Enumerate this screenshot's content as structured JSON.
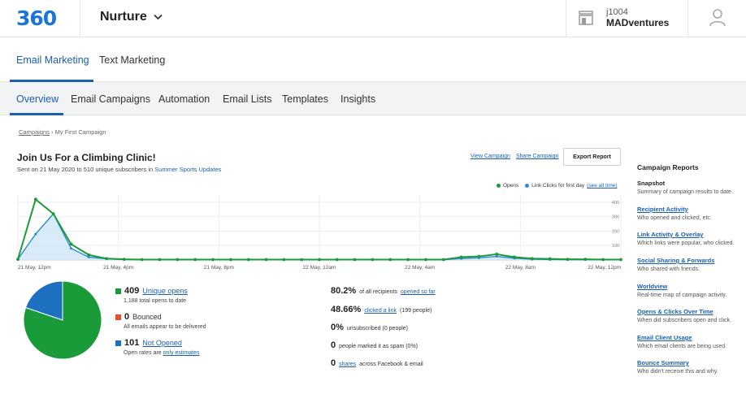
{
  "header": {
    "logo_text": "360",
    "product": "Nurture",
    "account_id": "j1004",
    "account_name": "MADventures"
  },
  "tabs_primary": [
    {
      "label": "Email Marketing",
      "active": true
    },
    {
      "label": "Text Marketing",
      "active": false
    }
  ],
  "tabs_secondary": [
    {
      "label": "Overview",
      "active": true
    },
    {
      "label": "Email Campaigns",
      "active": false
    },
    {
      "label": "Automation",
      "active": false
    },
    {
      "label": "Email Lists",
      "active": false
    },
    {
      "label": "Templates",
      "active": false
    },
    {
      "label": "Insights",
      "active": false
    }
  ],
  "breadcrumb": {
    "root": "Campaigns",
    "separator": "›",
    "current": "My First Campaign"
  },
  "campaign": {
    "title": "Join Us For a Climbing Clinic!",
    "sent_prefix": "Sent on 21 May 2020 to 510 unique subscribers in",
    "list_name": "Summer Sports Updates",
    "view_link": "View Campaign",
    "share_link": "Share Campaign",
    "export_label": "Export Report"
  },
  "legend": {
    "opens": "Opens",
    "clicks": "Link Clicks for first day",
    "see_all": "(see all time)"
  },
  "colors": {
    "opens": "#1a9b3a",
    "clicks": "#2a8ad4",
    "bounced": "#e8502a",
    "not_opened": "#1d6fbf",
    "brand": "#1a5fb4"
  },
  "chart_data": {
    "type": "line",
    "x_ticks": [
      "21 May, 12pm",
      "21 May, 4pm",
      "21 May, 8pm",
      "22 May, 12am",
      "22 May, 4am",
      "22 May, 8am",
      "22 May, 12pm"
    ],
    "y_ticks": [
      "400",
      "300",
      "200",
      "100"
    ],
    "ylim": [
      0,
      450
    ],
    "series": [
      {
        "name": "Opens",
        "values": [
          5,
          420,
          320,
          110,
          35,
          10,
          5,
          3,
          3,
          3,
          3,
          3,
          3,
          3,
          3,
          3,
          3,
          3,
          3,
          3,
          3,
          3,
          3,
          3,
          3,
          20,
          25,
          40,
          20,
          10,
          8,
          5,
          5,
          3,
          3
        ]
      },
      {
        "name": "Link Clicks for first day",
        "values": [
          5,
          180,
          320,
          80,
          20,
          8,
          3,
          2,
          2,
          2,
          2,
          2,
          2,
          2,
          2,
          2,
          2,
          2,
          2,
          2,
          2,
          2,
          2,
          2,
          2,
          10,
          15,
          25,
          12,
          5,
          3,
          2,
          2,
          2,
          2
        ]
      }
    ]
  },
  "pie": {
    "opened": 409,
    "bounced": 0,
    "not_opened": 101
  },
  "stats": {
    "opens_num": "409",
    "opens_link": "Unique opens",
    "opens_sub": "1,188 total opens to date",
    "bounced_num": "0",
    "bounced_label": "Bounced",
    "bounced_sub": "All emails appear to be delivered",
    "notopened_num": "101",
    "notopened_link": "Not Opened",
    "notopened_sub_prefix": "Open rates are",
    "notopened_sub_link": "only estimates"
  },
  "metrics": [
    {
      "big": "80.2%",
      "pre": "of all recipients",
      "link": "opened so far",
      "post": ""
    },
    {
      "big": "48.66%",
      "pre": "",
      "link": "clicked a link",
      "post": "(199 people)"
    },
    {
      "big": "0%",
      "pre": "unsubscribed (0 people)",
      "link": "",
      "post": ""
    },
    {
      "big": "0",
      "pre": "people marked it as spam (0%)",
      "link": "",
      "post": ""
    },
    {
      "big": "0",
      "pre": "",
      "link": "shares",
      "post": "across Facebook & email"
    }
  ],
  "sidebar": {
    "title": "Campaign Reports",
    "items": [
      {
        "head": "Snapshot",
        "desc": "Summary of campaign results to date.",
        "plain": true
      },
      {
        "head": "Recipient Activity",
        "desc": "Who opened and clicked, etc."
      },
      {
        "head": "Link Activity & Overlay",
        "desc": "Which links were popular, who clicked."
      },
      {
        "head": "Social Sharing & Forwards",
        "desc": "Who shared with friends."
      },
      {
        "head": "Worldview",
        "desc": "Real-time map of campaign activity."
      },
      {
        "head": "Opens & Clicks Over Time",
        "desc": "When did subscribers open and click."
      },
      {
        "head": "Email Client Usage",
        "desc": "Which email clients are being used."
      },
      {
        "head": "Bounce Summary",
        "desc": "Who didn't receive this and why."
      }
    ]
  }
}
